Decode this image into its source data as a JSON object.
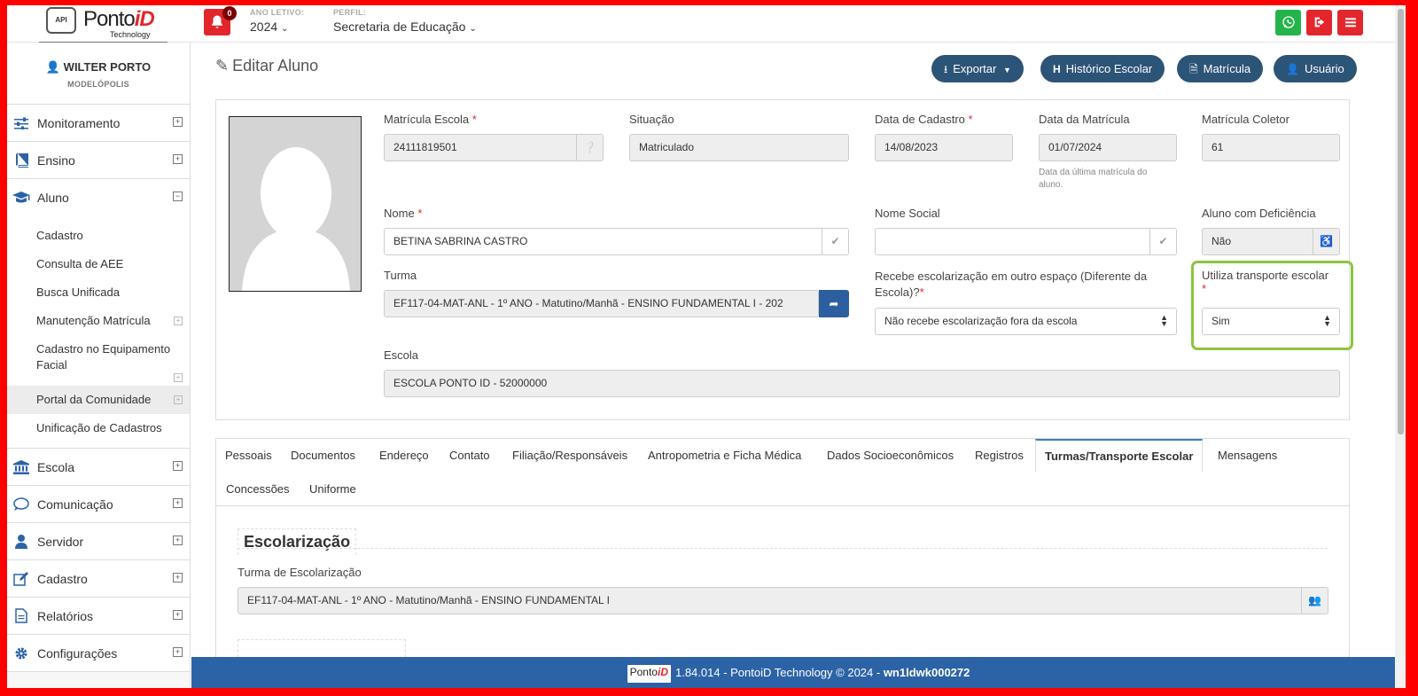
{
  "header": {
    "logo_brand": "Ponto",
    "logo_brand_accent": "iD",
    "logo_tech": "Technology",
    "logo_api": "API",
    "notification_count": "0",
    "ano_letivo_label": "ANO LETIVO:",
    "ano_letivo_value": "2024",
    "perfil_label": "PERFIL:",
    "perfil_value": "Secretaria de Educação"
  },
  "sidebar": {
    "user_name": "WILTER PORTO",
    "user_city": "MODELÓPOLIS",
    "menu": [
      {
        "label": "Monitoramento",
        "icon": "sliders-icon"
      },
      {
        "label": "Ensino",
        "icon": "book-icon"
      },
      {
        "label": "Aluno",
        "icon": "graduation-cap-icon"
      }
    ],
    "aluno_submenu": [
      "Cadastro",
      "Consulta de AEE",
      "Busca Unificada",
      "Manutenção Matrícula",
      "Cadastro no Equipamento Facial",
      "Portal da Comunidade",
      "Unificação de Cadastros"
    ],
    "menu_bottom": [
      {
        "label": "Escola",
        "icon": "bank-icon"
      },
      {
        "label": "Comunicação",
        "icon": "chat-icon"
      },
      {
        "label": "Servidor",
        "icon": "user-icon"
      },
      {
        "label": "Cadastro",
        "icon": "edit-icon"
      },
      {
        "label": "Relatórios",
        "icon": "file-icon"
      },
      {
        "label": "Configurações",
        "icon": "gear-icon"
      }
    ]
  },
  "page": {
    "title": "Editar Aluno",
    "actions": {
      "exportar": "Exportar",
      "historico": "Histórico Escolar",
      "matricula": "Matrícula",
      "usuario": "Usuário"
    }
  },
  "form": {
    "matricula_escola": {
      "label": "Matrícula Escola",
      "value": "24111819501"
    },
    "situacao": {
      "label": "Situação",
      "value": "Matriculado"
    },
    "data_cadastro": {
      "label": "Data de Cadastro",
      "value": "14/08/2023"
    },
    "data_matricula": {
      "label": "Data da Matrícula",
      "value": "01/07/2024",
      "help": "Data da última matrícula do aluno."
    },
    "matricula_coletor": {
      "label": "Matrícula Coletor",
      "value": "61"
    },
    "nome": {
      "label": "Nome",
      "value": "BETINA SABRINA CASTRO"
    },
    "nome_social": {
      "label": "Nome Social",
      "value": ""
    },
    "aluno_deficiencia": {
      "label": "Aluno com Deficiência",
      "value": "Não"
    },
    "turma": {
      "label": "Turma",
      "value": "EF117-04-MAT-ANL - 1º ANO - Matutino/Manhã - ENSINO FUNDAMENTAL I - 202"
    },
    "recebe_escolarizacao": {
      "label": "Recebe escolarização em outro espaço (Diferente da Escola)?",
      "value": "Não recebe escolarização fora da escola"
    },
    "transporte": {
      "label": "Utiliza transporte escolar",
      "value": "Sim"
    },
    "escola": {
      "label": "Escola",
      "value": "ESCOLA PONTO ID - 52000000"
    },
    "required_mark": "*"
  },
  "tabs": [
    "Pessoais",
    "Documentos",
    "Endereço",
    "Contato",
    "Filiação/Responsáveis",
    "Antropometria e Ficha Médica",
    "Dados Socioeconômicos",
    "Registros",
    "Turmas/Transporte Escolar",
    "Mensagens",
    "Concessões",
    "Uniforme"
  ],
  "active_tab": "Turmas/Transporte Escolar",
  "escolarizacao": {
    "legend": "Escolarização",
    "turma_label": "Turma de Escolarização",
    "turma_value": "EF117-04-MAT-ANL - 1º ANO - Matutino/Manhã - ENSINO FUNDAMENTAL I"
  },
  "footer": {
    "logo_brand": "Ponto",
    "logo_accent": "iD",
    "text": "1.84.014 - PontoiD Technology © 2024 - ",
    "host": "wn1ldwk000272"
  },
  "colors": {
    "accent": "#2c5477",
    "danger": "#e3262b",
    "whatsapp": "#25b34b",
    "highlight": "#8ac43f",
    "footer": "#2c63a6"
  }
}
